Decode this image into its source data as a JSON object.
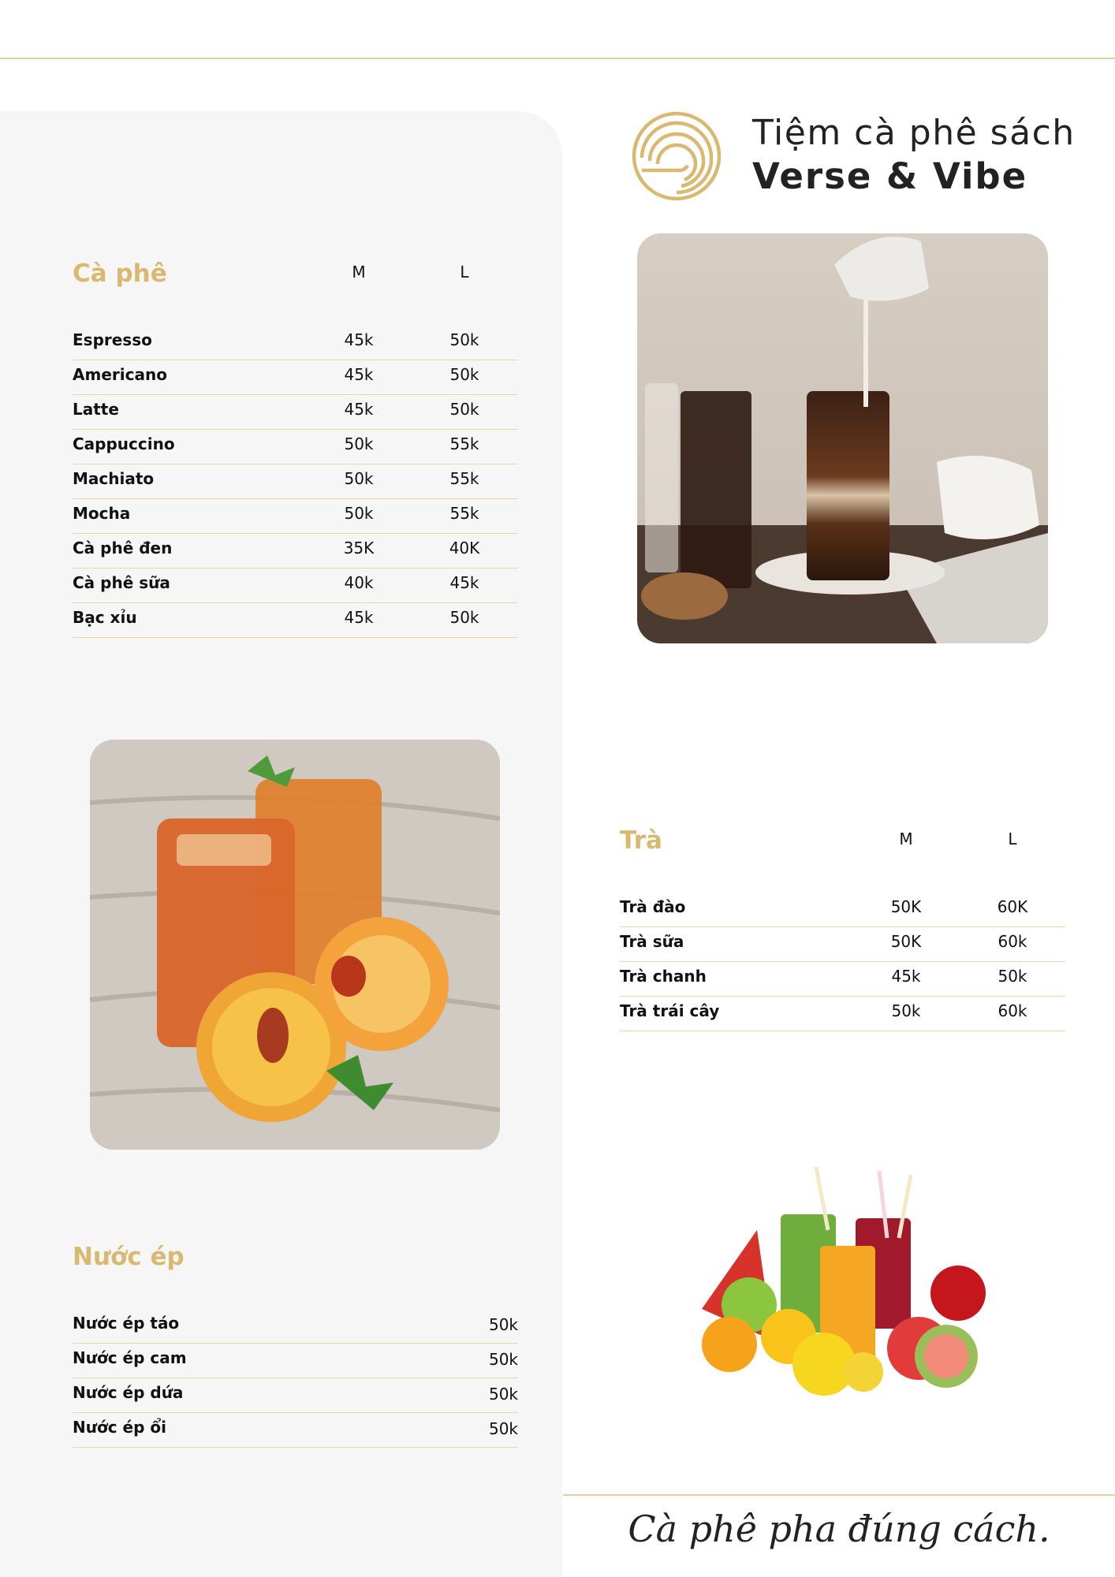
{
  "brand": {
    "line1": "Tiệm cà phê sách",
    "line2": "Verse & Vibe",
    "logo_icon": "concentric-arcs-logo",
    "accent_color": "#d9b86f"
  },
  "coffee": {
    "title": "Cà phê",
    "col_m": "M",
    "col_l": "L",
    "items": [
      {
        "name": "Espresso",
        "m": "45k",
        "l": "50k"
      },
      {
        "name": "Americano",
        "m": "45k",
        "l": "50k"
      },
      {
        "name": "Latte",
        "m": "45k",
        "l": "50k"
      },
      {
        "name": "Cappuccino",
        "m": "50k",
        "l": "55k"
      },
      {
        "name": "Machiato",
        "m": "50k",
        "l": "55k"
      },
      {
        "name": "Mocha",
        "m": "50k",
        "l": "55k"
      },
      {
        "name": "Cà phê đen",
        "m": "35K",
        "l": "40K"
      },
      {
        "name": "Cà phê sữa",
        "m": "40k",
        "l": "45k"
      },
      {
        "name": "Bạc xỉu",
        "m": "45k",
        "l": "50k"
      }
    ]
  },
  "tea": {
    "title": "Trà",
    "col_m": "M",
    "col_l": "L",
    "items": [
      {
        "name": "Trà đào",
        "m": "50K",
        "l": "60K"
      },
      {
        "name": "Trà sữa",
        "m": "50K",
        "l": "60k"
      },
      {
        "name": "Trà chanh",
        "m": "45k",
        "l": "50k"
      },
      {
        "name": "Trà trái cây",
        "m": "50k",
        "l": "60k"
      }
    ]
  },
  "juice": {
    "title": "Nước ép",
    "items": [
      {
        "name": "Nước ép táo",
        "price": "50k"
      },
      {
        "name": "Nước ép cam",
        "price": "50k"
      },
      {
        "name": "Nước ép dứa",
        "price": "50k"
      },
      {
        "name": "Nước ép ổi",
        "price": "50k"
      }
    ]
  },
  "tagline": "Cà phê pha đúng cách.",
  "photos": {
    "coffee": "iced-coffee-milk-pour-photo",
    "tea": "peach-iced-tea-photo",
    "juice": "fruit-juices-photo"
  }
}
